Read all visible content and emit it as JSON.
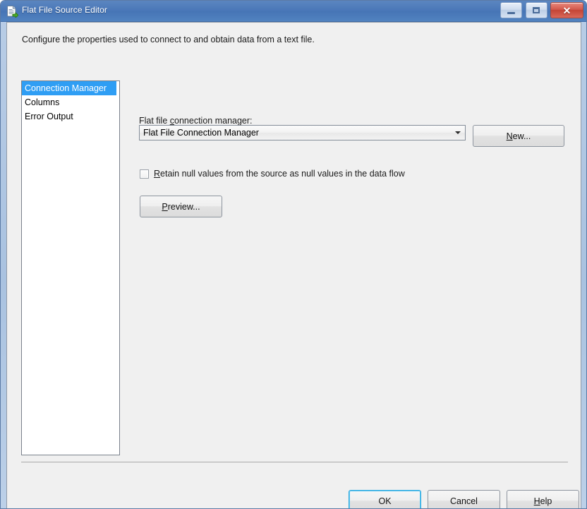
{
  "window": {
    "title": "Flat File Source Editor",
    "icon": "flat-file-source-icon",
    "controls": {
      "minimize_label": "–",
      "maximize_label": "□",
      "close_label": "✕"
    }
  },
  "instruction": "Configure the properties used to connect to and obtain data from a text file.",
  "nav": {
    "items": [
      {
        "label": "Connection Manager",
        "selected": true
      },
      {
        "label": "Columns",
        "selected": false
      },
      {
        "label": "Error Output",
        "selected": false
      }
    ]
  },
  "form": {
    "connection_label_pre": "Flat file ",
    "connection_label_accel": "c",
    "connection_label_post": "onnection manager:",
    "connection_value": "Flat File Connection Manager",
    "connection_options": [
      "Flat File Connection Manager"
    ],
    "new_button_accel": "N",
    "new_button_post": "ew...",
    "retain_null_accel": "R",
    "retain_null_post": "etain null values from the source as null values in the data flow",
    "retain_null_checked": false,
    "preview_button_accel": "P",
    "preview_button_post": "review..."
  },
  "footer": {
    "ok_label": "OK",
    "cancel_label": "Cancel",
    "help_accel": "H",
    "help_post": "elp"
  },
  "colors": {
    "titlebar": "#4a77b8",
    "selection": "#2f9ef4",
    "body": "#f0f0f0",
    "default_button_focus": "#29a8e0",
    "close_button": "#c44536"
  }
}
